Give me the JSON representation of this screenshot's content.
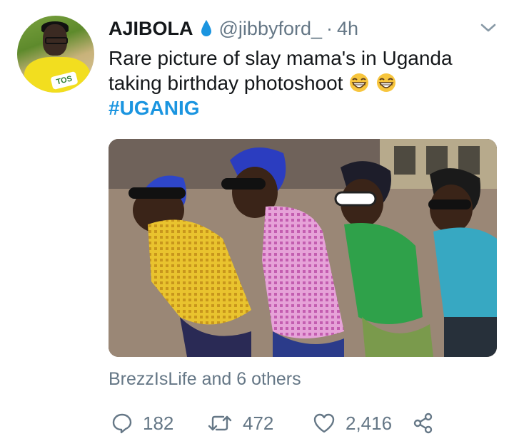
{
  "tweet": {
    "author": {
      "display_name": "AJIBOLA",
      "handle": "@jibbyford_",
      "avatar_badge": "TOS",
      "verified_icon": "water-drop-icon"
    },
    "separator": "·",
    "time": "4h",
    "text_line_1": "Rare picture of slay mama's in Uganda",
    "text_line_2": "taking birthday photoshoot",
    "emojis": [
      "grinning-squinting-face-icon",
      "grinning-squinting-face-icon"
    ],
    "hashtag": "#UGANIG",
    "liked_by": "BrezzIsLife and 6 others",
    "actions": {
      "reply_count": "182",
      "retweet_count": "472",
      "like_count": "2,416"
    }
  },
  "colors": {
    "text": "#14171a",
    "secondary": "#657786",
    "link": "#1b95e0",
    "drop": "#1b95e0"
  },
  "icons": [
    "reply-icon",
    "retweet-icon",
    "heart-icon",
    "share-icon",
    "chevron-down-icon"
  ]
}
